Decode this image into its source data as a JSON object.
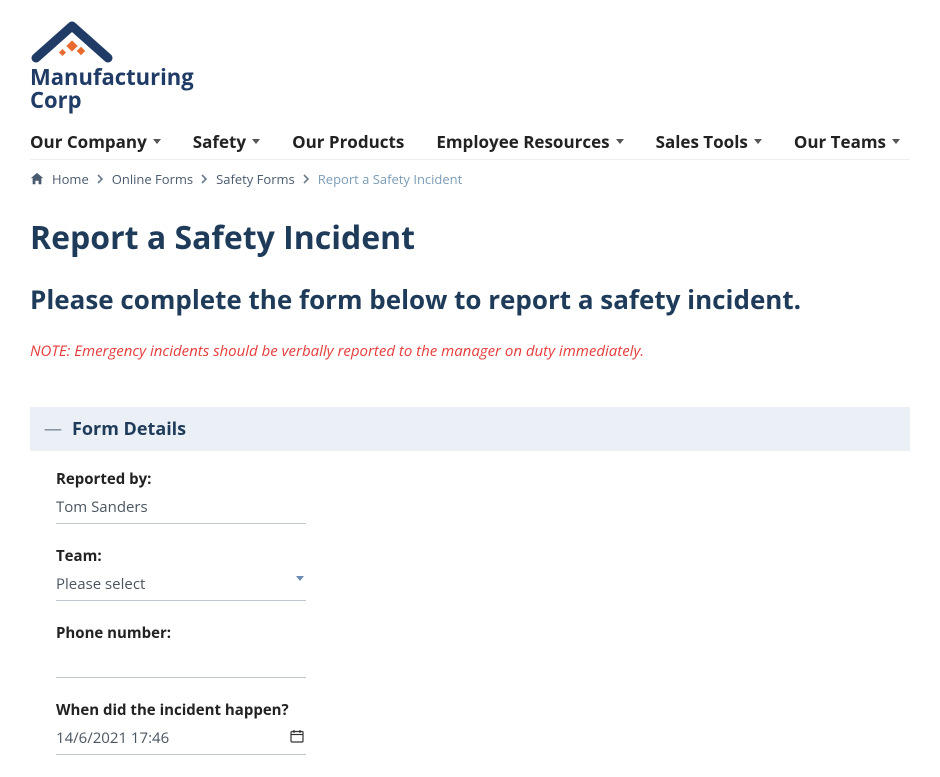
{
  "logo": {
    "line1": "Manufacturing",
    "line2": "Corp"
  },
  "nav": {
    "items": [
      {
        "label": "Our Company",
        "hasDropdown": true
      },
      {
        "label": "Safety",
        "hasDropdown": true
      },
      {
        "label": "Our Products",
        "hasDropdown": false
      },
      {
        "label": "Employee Resources",
        "hasDropdown": true
      },
      {
        "label": "Sales Tools",
        "hasDropdown": true
      },
      {
        "label": "Our Teams",
        "hasDropdown": true
      }
    ]
  },
  "breadcrumb": {
    "items": [
      {
        "label": "Home"
      },
      {
        "label": "Online Forms"
      },
      {
        "label": "Safety Forms"
      },
      {
        "label": "Report a Safety Incident"
      }
    ]
  },
  "page": {
    "title": "Report a Safety Incident",
    "subtitle": "Please complete the form below to report a safety incident.",
    "note": "NOTE: Emergency incidents should be verbally reported to the manager on duty immediately."
  },
  "section": {
    "title": "Form Details"
  },
  "form": {
    "reported_by": {
      "label": "Reported by:",
      "value": "Tom Sanders"
    },
    "team": {
      "label": "Team:",
      "placeholder": "Please select"
    },
    "phone": {
      "label": "Phone number:",
      "value": ""
    },
    "incident_when": {
      "label": "When did the incident happen?",
      "value": "14/6/2021 17:46"
    }
  }
}
